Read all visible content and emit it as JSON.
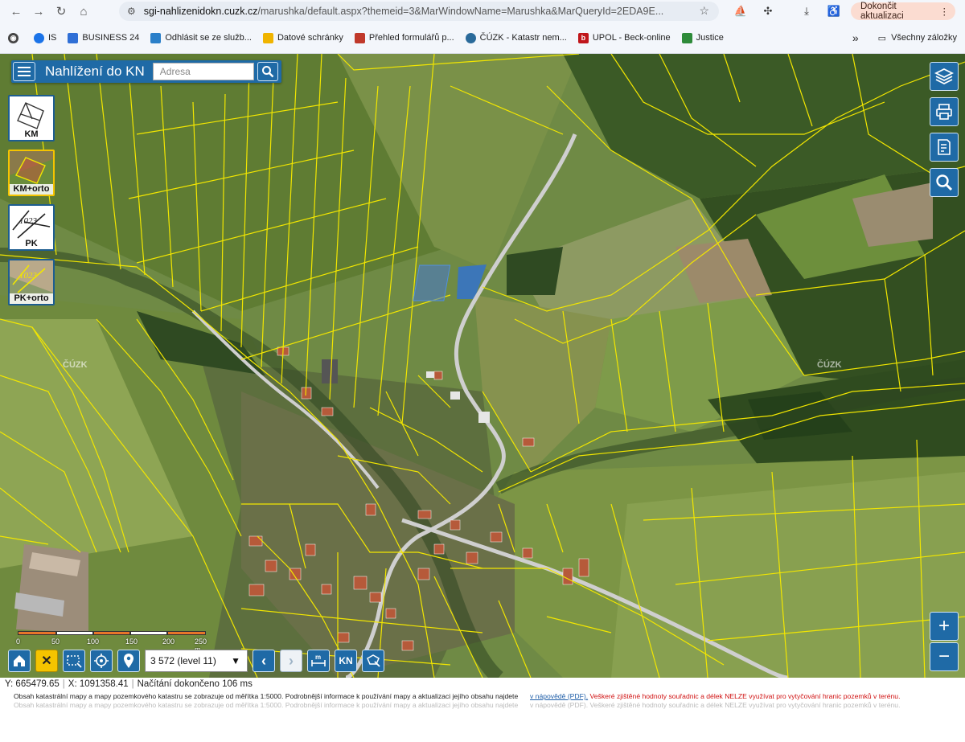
{
  "browser": {
    "url_host": "sgi-nahlizenidokn.cuzk.cz",
    "url_path": "/marushka/default.aspx?themeid=3&MarWindowName=Marushka&MarQueryId=2EDA9E...",
    "update_label": "Dokončit aktualizaci",
    "bookmarks": [
      {
        "label": "IS",
        "color": "#1a73e8"
      },
      {
        "label": "BUSINESS 24",
        "color": "#2f6fd6"
      },
      {
        "label": "Odhlásit se ze služb...",
        "color": "#2a7fc9"
      },
      {
        "label": "Datové schránky",
        "color": "#f0b400"
      },
      {
        "label": "Přehled formulářů p...",
        "color": "#c0392b"
      },
      {
        "label": "ČÚZK - Katastr nem...",
        "color": "#2a6a9a"
      },
      {
        "label": "UPOL - Beck-online",
        "color": "#c0161b"
      },
      {
        "label": "Justice",
        "color": "#2e8b3a"
      }
    ],
    "all_bookmarks": "Všechny záložky",
    "overflow": "»"
  },
  "app": {
    "title": "Nahlížení do KN",
    "search_placeholder": "Adresa",
    "layers": [
      {
        "label": "KM",
        "active": false
      },
      {
        "label": "KM+orto",
        "active": true
      },
      {
        "label": "PK",
        "active": false
      },
      {
        "label": "PK+orto",
        "active": false
      }
    ],
    "watermark": "ČÚZK",
    "scale_labels": [
      "0",
      "50",
      "100",
      "150",
      "200",
      "250 m"
    ],
    "scale_value": "3 572 (level 11)",
    "zoom_in": "+",
    "zoom_out": "−",
    "kn_label": "KN",
    "m_label": "m"
  },
  "status": {
    "y": "Y: 665479.65",
    "x": "X: 1091358.41",
    "load": "Načítání dokončeno 106 ms"
  },
  "info": {
    "text": "Obsah katastrální mapy a mapy pozemkového katastru se zobrazuje od měřítka 1:5000. Podrobnější informace k používání mapy a aktualizaci jejího obsahu najdete",
    "link": "v nápovědě (PDF).",
    "warning": "Veškeré zjištěné hodnoty souřadnic a délek NELZE využívat pro vytyčování hranic pozemků v terénu."
  },
  "colors": {
    "accent": "#1f6aa6",
    "parcel_lines": "#f2e600",
    "highlight": "#f5c400",
    "warning": "#d01010"
  }
}
